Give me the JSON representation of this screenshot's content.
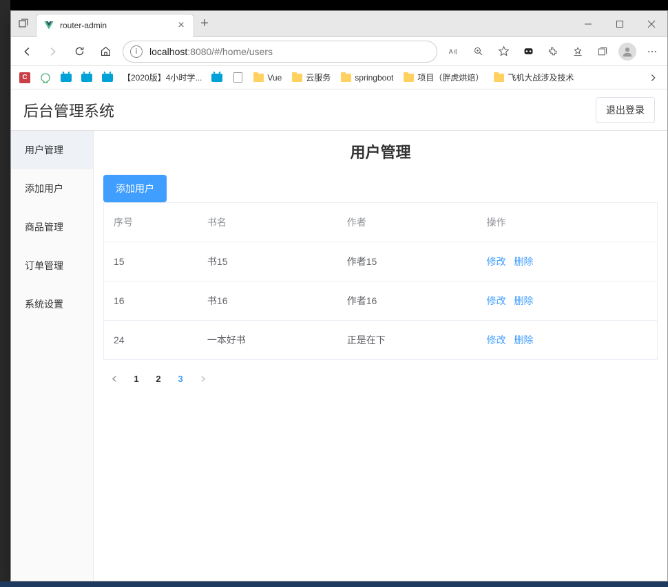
{
  "browser": {
    "tab_title": "router-admin",
    "url_host": "localhost",
    "url_port_path": ":8080/#/home/users"
  },
  "bookmarks": {
    "item_1": "【2020版】4小时学...",
    "folder_1": "Vue",
    "folder_2": "云服务",
    "folder_3": "springboot",
    "folder_4": "项目（胖虎烘焙）",
    "folder_5": "飞机大战涉及技术"
  },
  "app": {
    "title": "后台管理系统",
    "logout": "退出登录"
  },
  "sidebar": {
    "items": [
      "用户管理",
      "添加用户",
      "商品管理",
      "订单管理",
      "系统设置"
    ]
  },
  "page": {
    "title": "用户管理",
    "add_button": "添加用户"
  },
  "table": {
    "headers": {
      "id": "序号",
      "name": "书名",
      "author": "作者",
      "actions": "操作"
    },
    "rows": [
      {
        "id": "15",
        "name": "书15",
        "author": "作者15"
      },
      {
        "id": "16",
        "name": "书16",
        "author": "作者16"
      },
      {
        "id": "24",
        "name": "一本好书",
        "author": "正是在下"
      }
    ],
    "actions": {
      "edit": "修改",
      "delete": "删除"
    }
  },
  "pagination": {
    "pages": [
      "1",
      "2",
      "3"
    ],
    "current": "3"
  }
}
